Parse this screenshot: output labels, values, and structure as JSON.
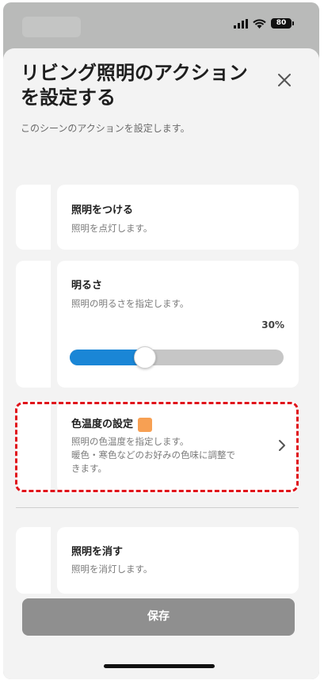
{
  "status_bar": {
    "battery": "80",
    "icons": [
      "signal-icon",
      "wifi-icon",
      "battery-icon"
    ]
  },
  "sheet": {
    "title": "リビング照明のアクションを設定する",
    "subtitle": "このシーンのアクションを設定します。"
  },
  "actions": [
    {
      "title": "照明をつける",
      "description": "照明を点灯します。"
    },
    {
      "title": "明るさ",
      "description": "照明の明るさを指定します。",
      "value_label": "30%",
      "value": 0.3
    },
    {
      "title": "色温度の設定",
      "description_line1": "照明の色温度を指定します。",
      "description_line2": "暖色・寒色などのお好みの色味に調整で",
      "description_line3": "きます。",
      "swatch_color": "#f7a053"
    },
    {
      "title": "照明を消す",
      "description": "照明を消灯します。"
    }
  ],
  "save_button": {
    "label": "保存"
  },
  "colors": {
    "highlight": "#e0141b",
    "slider_accent": "#1a86d6",
    "save_disabled": "#8f8f8f"
  }
}
